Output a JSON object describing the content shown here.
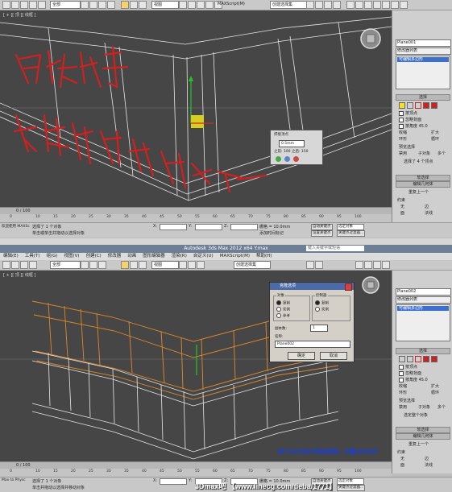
{
  "win1": {
    "selector": "全部",
    "view": "视图",
    "create_selection": "创建选择集",
    "maxscript": "MAXScript(M)",
    "viewport_label": "[ + ][ 顶 ][ 线框 ]",
    "handwriting": [
      "用焊接命令",
      "全焊接中部的点"
    ],
    "weld_popup": {
      "title": "焊接顶点",
      "value": "0.5mm",
      "second_row": "之前: 100 之后: 150"
    },
    "cmd": {
      "name": "Plane001",
      "modifier_list": "修改器列表",
      "stack_item": "可编辑多边形",
      "rollout_select": "选择",
      "by_vertex": "按顶点",
      "ignore_back": "忽略背面",
      "by_angle": "按角度",
      "angle_val": "45.0",
      "shrink": "收缩",
      "grow": "扩大",
      "ring": "环形",
      "loop": "循环",
      "preview": "预览选择",
      "disabled": "禁用",
      "subobj": "子对象",
      "multi": "多个",
      "status": "选择了 4 个顶点",
      "soft_sel": "软选择",
      "edit_geo": "编辑几何体",
      "repeat": "重复上一个",
      "constraint": "约束",
      "none": "无",
      "face": "面",
      "edge": "边",
      "normal": "法线"
    },
    "timeline": {
      "frame": "0 / 100"
    },
    "ruler": [
      "0",
      "10",
      "15",
      "20",
      "25",
      "30",
      "35",
      "40",
      "45",
      "50",
      "55",
      "60",
      "65",
      "70",
      "75",
      "80",
      "85",
      "90",
      "95",
      "100"
    ],
    "status": {
      "welcome": "欢迎使用 MAXSc",
      "line1": "选择了 1 个对象",
      "line2": "单击或单击并拖动以选择对象",
      "x": "X:",
      "xval": "",
      "y": "Y:",
      "yval": "",
      "z": "Z:",
      "zval": "",
      "grid": "栅格 = 10.0mm",
      "auto_key": "自动关键点",
      "select_obj": "选定对象",
      "set_key": "设置关键点",
      "key_filter": "关键点过滤器...",
      "add_time_tag": "添加时间标记"
    }
  },
  "win2": {
    "title": "Autodesk 3ds Max 2012 x64   Y.max",
    "search_placeholder": "键入关键字或短语",
    "menus": [
      "编辑(E)",
      "工具(T)",
      "组(G)",
      "视图(V)",
      "创建(C)",
      "修改器",
      "动画",
      "图形编辑器",
      "渲染(R)",
      "自定义(U)",
      "MAXScript(M)",
      "帮助(H)"
    ],
    "selector": "全部",
    "view": "视图",
    "create_selection": "创建选择集",
    "viewport_label": "[ + ][ 顶 ][ 线框 ]",
    "annotation": "按下Shift进行拖动复制，尽量对齐对齐",
    "dialog": {
      "title": "克隆选项",
      "obj_group": "对象",
      "copy": "复制",
      "instance": "实例",
      "reference": "参考",
      "ctrl_group": "控制器",
      "ctrl_copy": "复制",
      "ctrl_instance": "实例",
      "count_label": "副本数:",
      "count": "1",
      "name_label": "名称:",
      "name": "Plane002",
      "ok": "确定",
      "cancel": "取消"
    },
    "cmd": {
      "name": "Plane002",
      "modifier_list": "修改器列表",
      "stack_item": "可编辑多边形",
      "rollout_select": "选择",
      "by_vertex": "按顶点",
      "ignore_back": "忽略背面",
      "by_angle": "按角度",
      "angle_val": "45.0",
      "shrink": "收缩",
      "grow": "扩大",
      "ring": "环形",
      "loop": "循环",
      "preview": "预览选择",
      "disabled": "禁用",
      "subobj": "子对象",
      "multi": "多个",
      "status": "选定整个对象",
      "soft_sel": "软选择",
      "edit_geo": "编辑几何体",
      "repeat": "重复上一个",
      "constraint": "约束",
      "none": "无",
      "face": "面",
      "edge": "边",
      "normal": "法线"
    },
    "timeline": {
      "frame": "0 / 100"
    },
    "ruler": [
      "0",
      "10",
      "15",
      "20",
      "25",
      "30",
      "35",
      "40",
      "45",
      "50",
      "55",
      "60",
      "65",
      "70",
      "75",
      "80",
      "85",
      "90",
      "95",
      "100"
    ],
    "status": {
      "welcome": "Max to Physc",
      "line1": "选择了 1 个对象",
      "line2": "单击并拖动以选择并移动对象",
      "x": "X:",
      "xval": "",
      "y": "Y:",
      "yval": "",
      "z": "Z:",
      "zval": "",
      "grid": "栅格 = 10.0mm",
      "auto_key": "自动关键点",
      "select_obj": "选定对象",
      "set_key": "设置关键点",
      "key_filter": "关键点过滤器...",
      "add_time_tag": "添加时间标记"
    }
  },
  "watermark": "3Dmax吧 【www.linecg.com/tieba/1771】",
  "colors": {
    "viewport": "#464646",
    "wire": "#e8e8e8",
    "orange": "#e08a2a",
    "red_ink": "#d1201f",
    "selection_blue": "#3b6fd0",
    "annotation_blue": "#1a3fd6"
  }
}
